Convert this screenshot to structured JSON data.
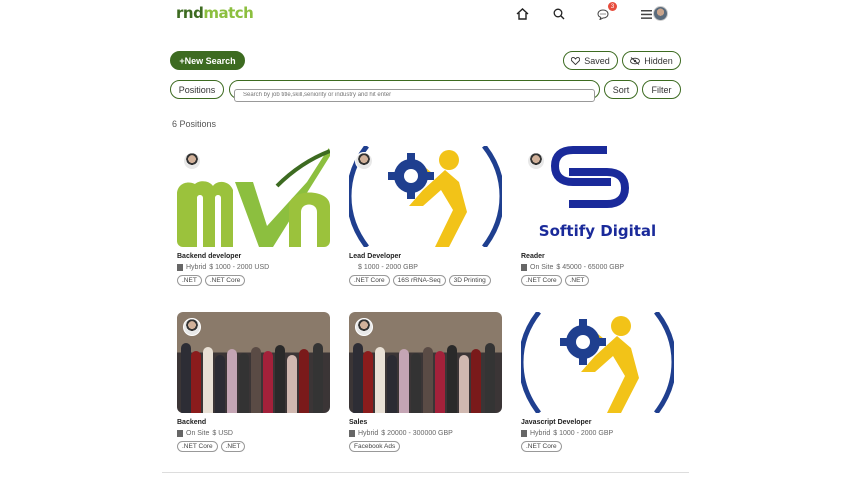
{
  "header": {
    "logo_part1": "rnd",
    "logo_part2": "match",
    "notification_count": "3"
  },
  "toolbar": {
    "new_search": "+New Search",
    "saved": "Saved",
    "hidden": "Hidden",
    "positions": "Positions",
    "search_placeholder": "Search by job title,skill,seniority or industry and hit enter",
    "sort": "Sort",
    "filter": "Filter"
  },
  "count_label": "6  Positions",
  "cards": [
    {
      "title": "Backend developer",
      "location": "Hybrid",
      "salary": "$ 1000 - 2000 USD",
      "tags": [
        ".NET",
        ".NET Core"
      ],
      "image": "mvp-logo"
    },
    {
      "title": "Lead Developer",
      "location": "",
      "salary": "$ 1000 - 2000 GBP",
      "tags": [
        ".NET Core",
        "16S rRNA-Seq",
        "3D Printing"
      ],
      "image": "gear-person"
    },
    {
      "title": "Reader",
      "location": "On Site",
      "salary": "$ 45000 - 65000 GBP",
      "tags": [
        ".NET Core",
        ".NET"
      ],
      "image": "softify",
      "brand": "Softify Digital"
    },
    {
      "title": "Backend",
      "location": "On Site",
      "salary": "$  USD",
      "tags": [
        ".NET Core",
        ".NET"
      ],
      "image": "team-photo"
    },
    {
      "title": "Sales",
      "location": "Hybrid",
      "salary": "$ 20000 - 300000 GBP",
      "tags": [
        "Facebook Ads"
      ],
      "image": "team-photo"
    },
    {
      "title": "Javascript Developer",
      "location": "Hybrid",
      "salary": "$ 1000 - 2000 GBP",
      "tags": [
        ".NET Core"
      ],
      "image": "gear-person"
    }
  ],
  "colors": {
    "brand_dark": "#3d6b21",
    "brand_light": "#8cbf3f",
    "gear_blue": "#1f3f8f",
    "person_yellow": "#f2c318"
  }
}
